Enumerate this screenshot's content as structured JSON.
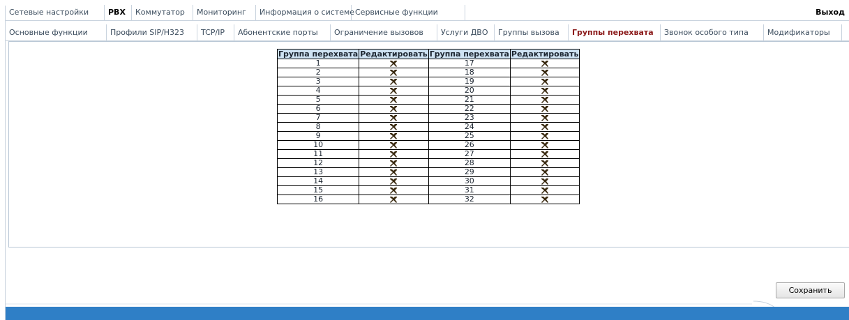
{
  "top_menu": {
    "items": [
      "Сетевые настройки",
      "PBX",
      "Коммутатор",
      "Мониторинг",
      "Информация о системе",
      "Сервисные функции"
    ],
    "active_index": 1,
    "logout": "Выход"
  },
  "sub_menu": {
    "tabs": [
      "Основные функции",
      "Профили SIP/H323",
      "TCP/IP",
      "Абонентские порты",
      "Ограничение вызовов",
      "Услуги ДВО",
      "Группы вызова",
      "Группы перехвата",
      "Звонок особого типа",
      "Модификаторы"
    ],
    "active_index": 7
  },
  "table": {
    "headers": [
      "Группа перехвата",
      "Редактировать",
      "Группа перехвата",
      "Редактировать"
    ],
    "rows": [
      [
        "1",
        "17"
      ],
      [
        "2",
        "18"
      ],
      [
        "3",
        "19"
      ],
      [
        "4",
        "20"
      ],
      [
        "5",
        "21"
      ],
      [
        "6",
        "22"
      ],
      [
        "7",
        "23"
      ],
      [
        "8",
        "24"
      ],
      [
        "9",
        "25"
      ],
      [
        "10",
        "26"
      ],
      [
        "11",
        "27"
      ],
      [
        "12",
        "28"
      ],
      [
        "13",
        "29"
      ],
      [
        "14",
        "30"
      ],
      [
        "15",
        "31"
      ],
      [
        "16",
        "32"
      ]
    ],
    "edit_icon": "tools-icon"
  },
  "save_button": "Сохранить",
  "colors": {
    "accent": "#8b1a1a",
    "header_bg": "#cfe3f3",
    "footer": "#2f7fc6"
  }
}
